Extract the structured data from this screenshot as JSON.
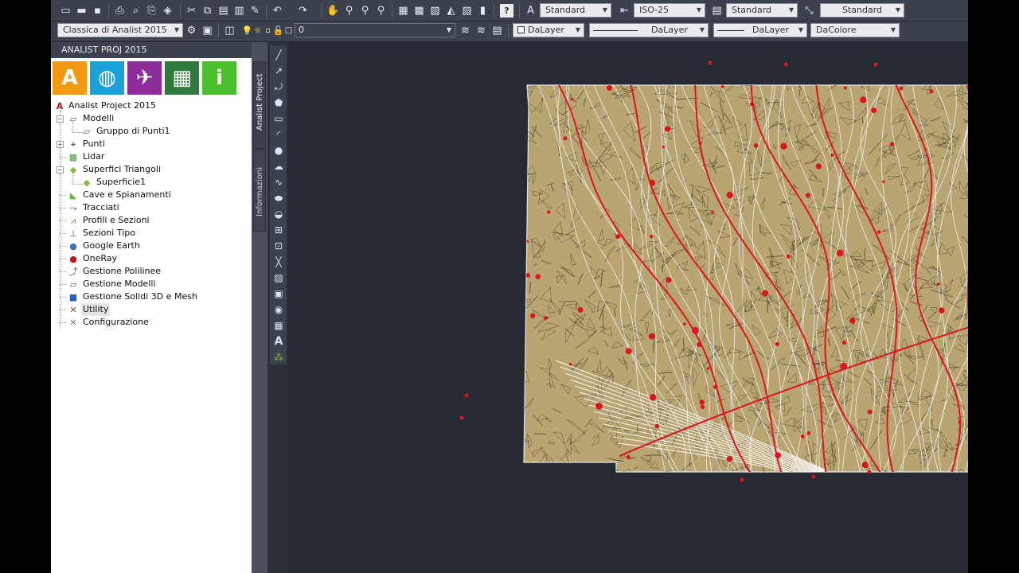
{
  "toolbar_top": {
    "text_style": "Standard",
    "dim_style": "ISO-25",
    "table_style": "Standard",
    "mleader_style": "Standard"
  },
  "toolbar_props": {
    "workspace": "Classica di Analist 2015",
    "layer": "0",
    "color": "DaLayer",
    "linetype": "DaLayer",
    "lineweight": "DaLayer",
    "plotstyle": "DaColore"
  },
  "panel": {
    "title": "ANALIST PROJ 2015",
    "tiles": [
      {
        "glyph": "A",
        "color": "#f39a12",
        "icon": "analist-logo-icon"
      },
      {
        "glyph": "◍",
        "color": "#1aa3d8",
        "icon": "globe-icon"
      },
      {
        "glyph": "✈",
        "color": "#8d2c9a",
        "icon": "satellite-icon"
      },
      {
        "glyph": "▦",
        "color": "#2d7a3a",
        "icon": "map-icon"
      },
      {
        "glyph": "i",
        "color": "#4bbf2d",
        "icon": "info-icon"
      }
    ],
    "tree": {
      "root": "Analist Project 2015",
      "items": [
        {
          "label": "Modelli",
          "icon": "models-icon",
          "glyph": "▱",
          "color": "#555"
        },
        {
          "label": "Gruppo di Punti1",
          "icon": "point-group-icon",
          "glyph": "▱",
          "color": "#555"
        },
        {
          "label": "Punti",
          "icon": "points-icon",
          "glyph": "⌖",
          "color": "#222"
        },
        {
          "label": "Lidar",
          "icon": "lidar-icon",
          "glyph": "▩",
          "color": "#4a9c3d"
        },
        {
          "label": "Superfici Triangoli",
          "icon": "surface-icon",
          "glyph": "◆",
          "color": "#7cbf3c"
        },
        {
          "label": "Superficie1",
          "icon": "surface-item-icon",
          "glyph": "◆",
          "color": "#7cbf3c"
        },
        {
          "label": "Cave e Spianamenti",
          "icon": "quarry-icon",
          "glyph": "◣",
          "color": "#6bb23a"
        },
        {
          "label": "Tracciati",
          "icon": "alignment-icon",
          "glyph": "⤳",
          "color": "#333"
        },
        {
          "label": "Profili e Sezioni",
          "icon": "profile-icon",
          "glyph": "⩘",
          "color": "#8a6d3b"
        },
        {
          "label": "Sezioni Tipo",
          "icon": "typical-section-icon",
          "glyph": "⊥",
          "color": "#555"
        },
        {
          "label": "Google Earth",
          "icon": "google-earth-icon",
          "glyph": "●",
          "color": "#3a72c6"
        },
        {
          "label": "OneRay",
          "icon": "oneray-icon",
          "glyph": "●",
          "color": "#c0141c"
        },
        {
          "label": "Gestione Polilinee",
          "icon": "polyline-icon",
          "glyph": "⤴",
          "color": "#555"
        },
        {
          "label": "Gestione Modelli",
          "icon": "model-manager-icon",
          "glyph": "▱",
          "color": "#555"
        },
        {
          "label": "Gestione Solidi 3D e Mesh",
          "icon": "solid-3d-icon",
          "glyph": "■",
          "color": "#2a5fc0"
        },
        {
          "label": "Utility",
          "icon": "utility-icon",
          "glyph": "✕",
          "color": "#8a5a2b"
        },
        {
          "label": "Configurazione",
          "icon": "configuration-icon",
          "glyph": "✕",
          "color": "#777"
        }
      ]
    }
  },
  "sidetabs": {
    "project": "Analist Project",
    "info": "Informazioni"
  },
  "drawbar_text_tool": "A"
}
